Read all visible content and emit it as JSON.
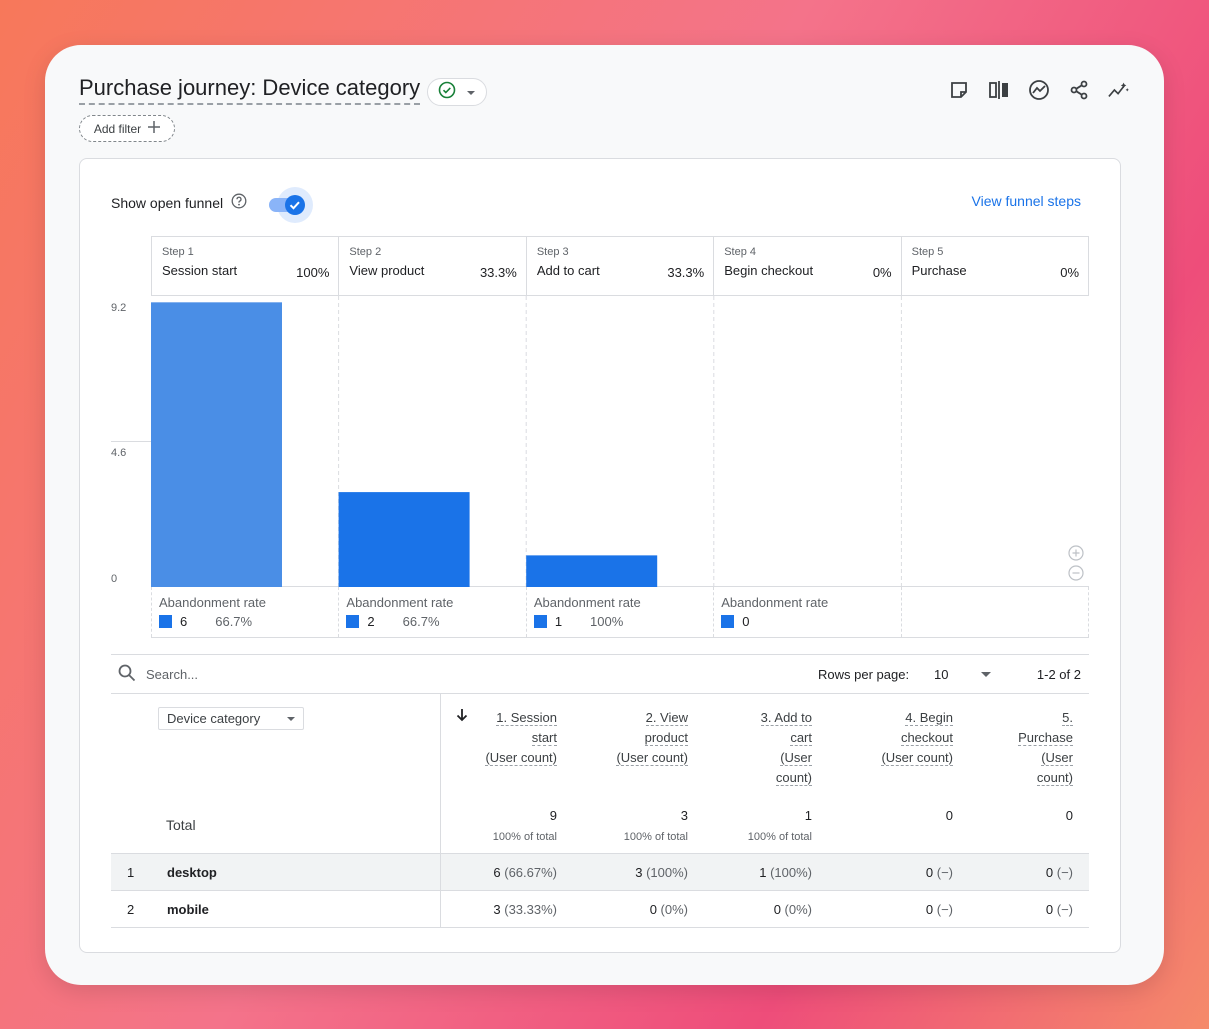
{
  "report": {
    "title": "Purchase journey: Device category",
    "add_filter_label": "Add filter"
  },
  "toolbar": {
    "icons": [
      "note-icon",
      "compare-icon",
      "insights-icon",
      "share-icon",
      "sparkline-icon"
    ]
  },
  "funnel": {
    "show_open_funnel_label": "Show open funnel",
    "view_funnel_steps_label": "View funnel steps",
    "open_funnel_enabled": true,
    "abandonment_label": "Abandonment rate",
    "steps": [
      {
        "num": "Step 1",
        "name": "Session start",
        "pct": "100%",
        "abandon_count": "6",
        "abandon_rate": "66.7%"
      },
      {
        "num": "Step 2",
        "name": "View product",
        "pct": "33.3%",
        "abandon_count": "2",
        "abandon_rate": "66.7%"
      },
      {
        "num": "Step 3",
        "name": "Add to cart",
        "pct": "33.3%",
        "abandon_count": "1",
        "abandon_rate": "100%"
      },
      {
        "num": "Step 4",
        "name": "Begin checkout",
        "pct": "0%",
        "abandon_count": "0",
        "abandon_rate": ""
      },
      {
        "num": "Step 5",
        "name": "Purchase",
        "pct": "0%",
        "abandon_count": "",
        "abandon_rate": ""
      }
    ]
  },
  "chart_data": {
    "type": "bar",
    "categories": [
      "Session start",
      "View product",
      "Add to cart",
      "Begin checkout",
      "Purchase"
    ],
    "values": [
      9,
      3,
      1,
      0,
      0
    ],
    "ylim": [
      0,
      9.2
    ],
    "yticks": [
      "9.2",
      "4.6",
      "0"
    ],
    "colors": [
      "#4a8ee6",
      "#1a73e8",
      "#1a73e8",
      "#1a73e8",
      "#1a73e8"
    ]
  },
  "table": {
    "search_placeholder": "Search...",
    "rows_per_page_label": "Rows per page:",
    "rows_per_page_value": "10",
    "paging_text": "1-2 of 2",
    "dimension_label": "Device category",
    "total_label": "Total",
    "columns": [
      {
        "lines": [
          "1. Session",
          "start",
          "(User count)"
        ],
        "total": "9",
        "total_sub": "100% of total"
      },
      {
        "lines": [
          "2. View",
          "product",
          "(User count)"
        ],
        "total": "3",
        "total_sub": "100% of total"
      },
      {
        "lines": [
          "3. Add to",
          "cart",
          "(User",
          "count)"
        ],
        "total": "1",
        "total_sub": "100% of total"
      },
      {
        "lines": [
          "4. Begin",
          "checkout",
          "(User count)"
        ],
        "total": "0",
        "total_sub": ""
      },
      {
        "lines": [
          "5.",
          "Purchase",
          "(User",
          "count)"
        ],
        "total": "0",
        "total_sub": ""
      }
    ],
    "rows": [
      {
        "idx": "1",
        "dim": "desktop",
        "cells": [
          [
            "6",
            " (66.67%)"
          ],
          [
            "3",
            " (100%)"
          ],
          [
            "1",
            " (100%)"
          ],
          [
            "0",
            " (−)"
          ],
          [
            "0",
            " (−)"
          ]
        ]
      },
      {
        "idx": "2",
        "dim": "mobile",
        "cells": [
          [
            "3",
            " (33.33%)"
          ],
          [
            "0",
            " (0%)"
          ],
          [
            "0",
            " (0%)"
          ],
          [
            "0",
            " (−)"
          ],
          [
            "0",
            " (−)"
          ]
        ]
      }
    ]
  }
}
